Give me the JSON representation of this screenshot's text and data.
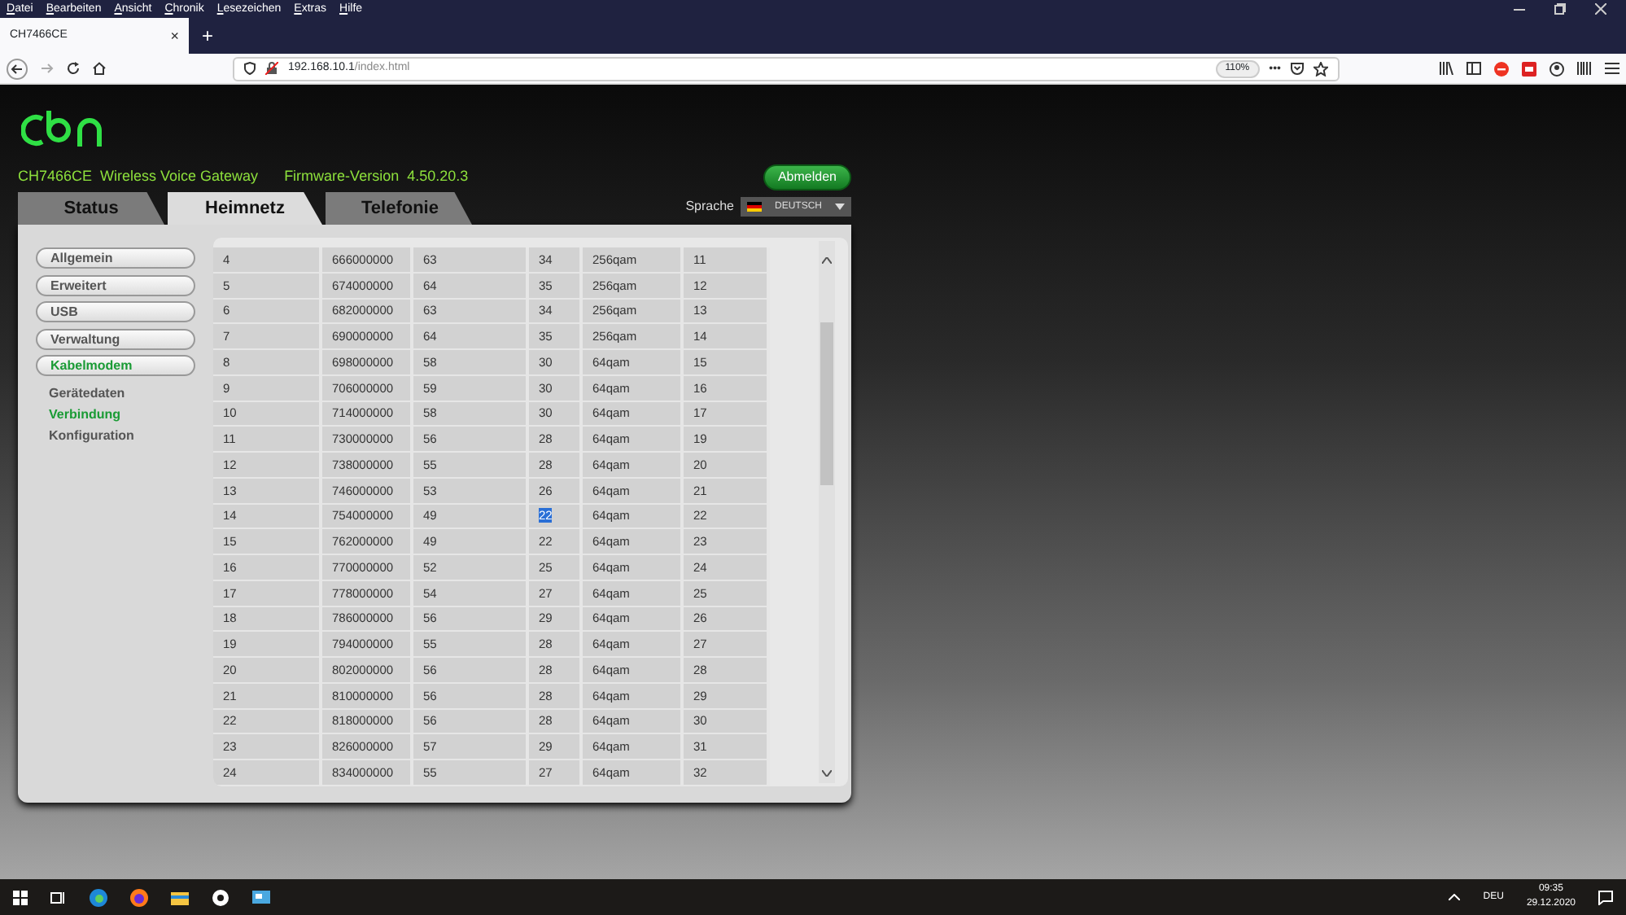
{
  "browser": {
    "menu": [
      "Datei",
      "Bearbeiten",
      "Ansicht",
      "Chronik",
      "Lesezeichen",
      "Extras",
      "Hilfe"
    ],
    "tab": {
      "title": "CH7466CE",
      "close": "×"
    },
    "new_tab": "+",
    "url": {
      "host": "192.168.10.1",
      "path": "/index.html"
    },
    "zoom": "110%",
    "page_actions": "•••"
  },
  "header": {
    "model": "CH7466CE  Wireless Voice Gateway",
    "firmware": "Firmware-Version  4.50.20.3",
    "logout": "Abmelden"
  },
  "tabs": [
    {
      "label": "Status",
      "selected": false
    },
    {
      "label": "Heimnetz",
      "selected": true
    },
    {
      "label": "Telefonie",
      "selected": false
    }
  ],
  "language": {
    "label": "Sprache",
    "value": "DEUTSCH"
  },
  "sidebar": {
    "items": [
      {
        "label": "Allgemein",
        "selected": false
      },
      {
        "label": "Erweitert",
        "selected": false
      },
      {
        "label": "USB",
        "selected": false
      },
      {
        "label": "Verwaltung",
        "selected": false
      },
      {
        "label": "Kabelmodem",
        "selected": true,
        "children": [
          {
            "label": "Gerätedaten",
            "selected": false
          },
          {
            "label": "Verbindung",
            "selected": true
          },
          {
            "label": "Konfiguration",
            "selected": false
          }
        ]
      }
    ]
  },
  "table": {
    "rows": [
      {
        "cells": [
          "4",
          "666000000",
          "63",
          "34",
          "256qam",
          "11"
        ],
        "column_4_highlighted": false
      },
      {
        "cells": [
          "5",
          "674000000",
          "64",
          "35",
          "256qam",
          "12"
        ],
        "column_4_highlighted": false
      },
      {
        "cells": [
          "6",
          "682000000",
          "63",
          "34",
          "256qam",
          "13"
        ],
        "column_4_highlighted": false
      },
      {
        "cells": [
          "7",
          "690000000",
          "64",
          "35",
          "256qam",
          "14"
        ],
        "column_4_highlighted": false
      },
      {
        "cells": [
          "8",
          "698000000",
          "58",
          "30",
          "64qam",
          "15"
        ],
        "column_4_highlighted": false
      },
      {
        "cells": [
          "9",
          "706000000",
          "59",
          "30",
          "64qam",
          "16"
        ],
        "column_4_highlighted": false
      },
      {
        "cells": [
          "10",
          "714000000",
          "58",
          "30",
          "64qam",
          "17"
        ],
        "column_4_highlighted": false
      },
      {
        "cells": [
          "11",
          "730000000",
          "56",
          "28",
          "64qam",
          "19"
        ],
        "column_4_highlighted": false
      },
      {
        "cells": [
          "12",
          "738000000",
          "55",
          "28",
          "64qam",
          "20"
        ],
        "column_4_highlighted": false
      },
      {
        "cells": [
          "13",
          "746000000",
          "53",
          "26",
          "64qam",
          "21"
        ],
        "column_4_highlighted": false
      },
      {
        "cells": [
          "14",
          "754000000",
          "49",
          "22",
          "64qam",
          "22"
        ],
        "column_4_highlighted": true
      },
      {
        "cells": [
          "15",
          "762000000",
          "49",
          "22",
          "64qam",
          "23"
        ],
        "column_4_highlighted": false
      },
      {
        "cells": [
          "16",
          "770000000",
          "52",
          "25",
          "64qam",
          "24"
        ],
        "column_4_highlighted": false
      },
      {
        "cells": [
          "17",
          "778000000",
          "54",
          "27",
          "64qam",
          "25"
        ],
        "column_4_highlighted": false
      },
      {
        "cells": [
          "18",
          "786000000",
          "56",
          "29",
          "64qam",
          "26"
        ],
        "column_4_highlighted": false
      },
      {
        "cells": [
          "19",
          "794000000",
          "55",
          "28",
          "64qam",
          "27"
        ],
        "column_4_highlighted": false
      },
      {
        "cells": [
          "20",
          "802000000",
          "56",
          "28",
          "64qam",
          "28"
        ],
        "column_4_highlighted": false
      },
      {
        "cells": [
          "21",
          "810000000",
          "56",
          "28",
          "64qam",
          "29"
        ],
        "column_4_highlighted": false
      },
      {
        "cells": [
          "22",
          "818000000",
          "56",
          "28",
          "64qam",
          "30"
        ],
        "column_4_highlighted": false
      },
      {
        "cells": [
          "23",
          "826000000",
          "57",
          "29",
          "64qam",
          "31"
        ],
        "column_4_highlighted": false
      },
      {
        "cells": [
          "24",
          "834000000",
          "55",
          "27",
          "64qam",
          "32"
        ],
        "column_4_highlighted": false
      }
    ]
  },
  "taskbar": {
    "language": "DEU",
    "time": "09:35",
    "date": "29.12.2020"
  }
}
